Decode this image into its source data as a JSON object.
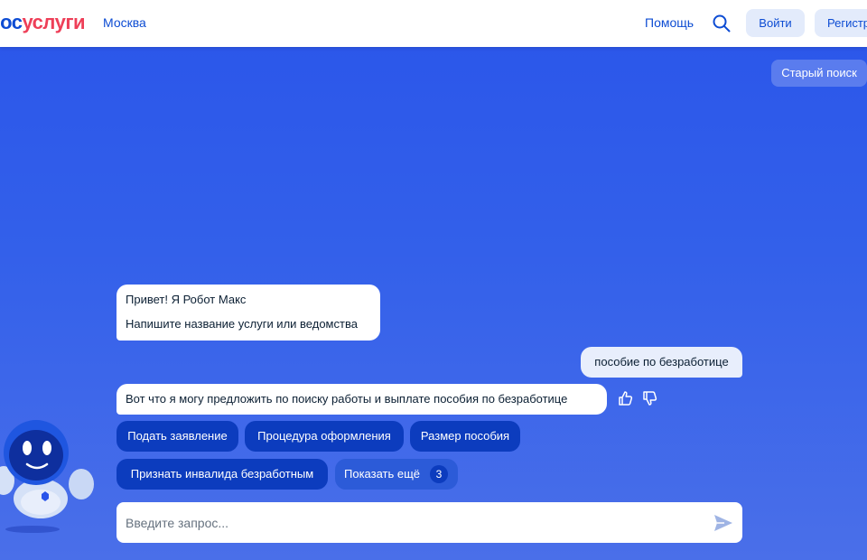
{
  "header": {
    "logo_part1": "ос",
    "logo_part2": "услуги",
    "city": "Москва",
    "help": "Помощь",
    "login_label": "Войти",
    "register_label": "Регистр",
    "search_icon": "search-icon"
  },
  "old_search_label": "Старый поиск",
  "chat": {
    "bot_greeting_line1": "Привет! Я Робот Макс",
    "bot_greeting_line2": "Напишите название услуги или ведомства",
    "user_message": "пособие по безработице",
    "bot_answer": "Вот что я могу предложить по поиску работы и выплате пособия по безработице",
    "feedback_icons": [
      "thumbs-up-icon",
      "thumbs-down-icon"
    ]
  },
  "chips": [
    {
      "label": "Подать заявление"
    },
    {
      "label": "Процедура оформления"
    },
    {
      "label": "Размер пособия"
    },
    {
      "label": "Признать инвалида безработным"
    },
    {
      "label": "Показать ещё",
      "count": "3"
    }
  ],
  "input": {
    "placeholder": "Введите запрос...",
    "value": ""
  },
  "colors": {
    "brand_blue": "#0d4cd3",
    "brand_red": "#ee3f58",
    "chip_dark": "#0c3cbe",
    "background_top": "#2a55ea"
  }
}
